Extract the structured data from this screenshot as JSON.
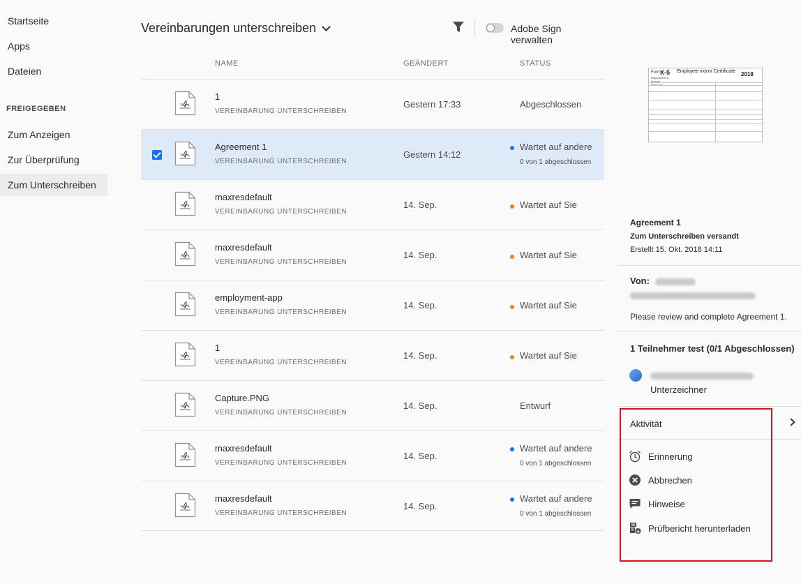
{
  "sidebar": {
    "items": [
      {
        "label": "Startseite"
      },
      {
        "label": "Apps"
      },
      {
        "label": "Dateien"
      }
    ],
    "section_heading": "FREIGEGEBEN",
    "shared_items": [
      {
        "label": "Zum Anzeigen"
      },
      {
        "label": "Zur Überprüfung"
      },
      {
        "label": "Zum Unterschreiben",
        "active": true
      }
    ]
  },
  "header": {
    "title": "Vereinbarungen unterschreiben",
    "toggle_label": "Adobe Sign verwalten"
  },
  "columns": {
    "name": "NAME",
    "changed": "GEÄNDERT",
    "status": "STATUS"
  },
  "rows": [
    {
      "name": "1",
      "type": "VEREINBARUNG UNTERSCHREIBEN",
      "date": "Gestern 17:33",
      "status": "Abgeschlossen",
      "sub": ""
    },
    {
      "name": "Agreement 1",
      "type": "VEREINBARUNG UNTERSCHREIBEN",
      "date": "Gestern 14:12",
      "status": "Wartet auf andere",
      "sub": "0 von 1 abgeschlossen"
    },
    {
      "name": "maxresdefault",
      "type": "VEREINBARUNG UNTERSCHREIBEN",
      "date": "14. Sep.",
      "status": "Wartet auf Sie",
      "sub": ""
    },
    {
      "name": "maxresdefault",
      "type": "VEREINBARUNG UNTERSCHREIBEN",
      "date": "14. Sep.",
      "status": "Wartet auf Sie",
      "sub": ""
    },
    {
      "name": "employment-app",
      "type": "VEREINBARUNG UNTERSCHREIBEN",
      "date": "14. Sep.",
      "status": "Wartet auf Sie",
      "sub": ""
    },
    {
      "name": "1",
      "type": "VEREINBARUNG UNTERSCHREIBEN",
      "date": "14. Sep.",
      "status": "Wartet auf Sie",
      "sub": ""
    },
    {
      "name": "Capture.PNG",
      "type": "VEREINBARUNG UNTERSCHREIBEN",
      "date": "14. Sep.",
      "status": "Entwurf",
      "sub": ""
    },
    {
      "name": "maxresdefault",
      "type": "VEREINBARUNG UNTERSCHREIBEN",
      "date": "14. Sep.",
      "status": "Wartet auf andere",
      "sub": "0 von 1 abgeschlossen"
    },
    {
      "name": "maxresdefault",
      "type": "VEREINBARUNG UNTERSCHREIBEN",
      "date": "14. Sep.",
      "status": "Wartet auf andere",
      "sub": "0 von 1 abgeschlossen"
    }
  ],
  "status_colors": {
    "waiting_others": "#1473e6",
    "waiting_you": "#e68619",
    "selection": "#deeaf8"
  },
  "thumbnail": {
    "form_label": "Form",
    "form_number": "X-5",
    "form_title": "Employee xxxxx Certificate",
    "dept": "Department of Human Resource",
    "year": "2018"
  },
  "details": {
    "title": "Agreement 1",
    "sent_status": "Zum Unterschreiben versandt",
    "created": "Erstellt 15. Okt. 2018 14:11",
    "from_label": "Von:",
    "message": "Please review and complete Agreement 1.",
    "participants_heading": "1 Teilnehmer test (0/1 Abgeschlossen)",
    "participant_role": "Unterzeichner",
    "activity_label": "Aktivität",
    "actions": [
      {
        "label": "Erinnerung",
        "icon": "alarm-clock-icon"
      },
      {
        "label": "Abbrechen",
        "icon": "cancel-circle-icon"
      },
      {
        "label": "Hinweise",
        "icon": "comment-icon"
      },
      {
        "label": "Prüfbericht herunterladen",
        "icon": "report-download-icon"
      }
    ],
    "highlight_color": "#d7141a"
  }
}
